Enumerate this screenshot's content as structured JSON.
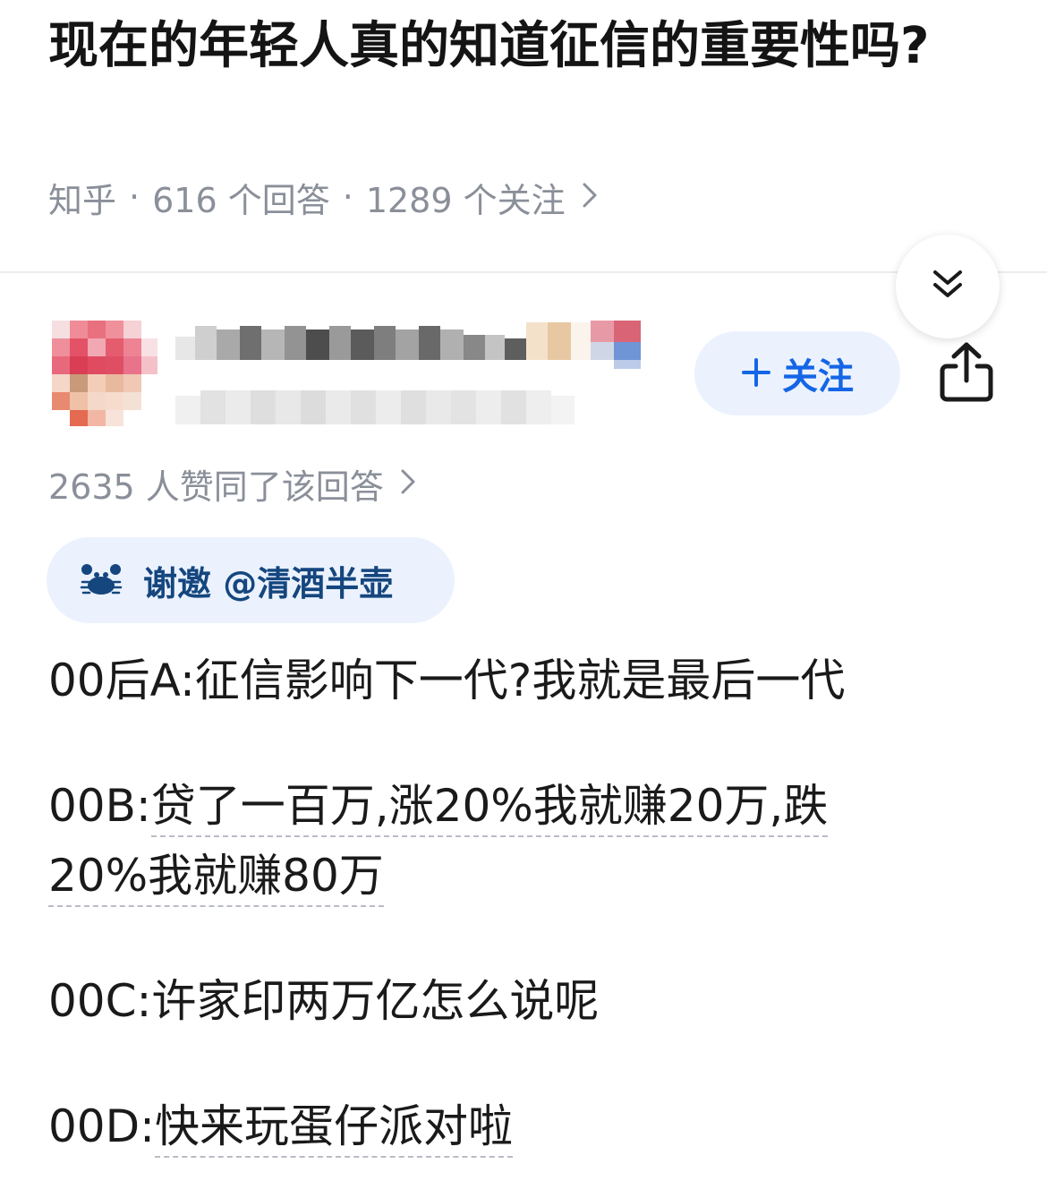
{
  "question": {
    "title": "现在的年轻人真的知道征信的重要性吗?",
    "source": "知乎",
    "separator": "·",
    "answers_count": "616 个回答",
    "followers_count": "1289 个关注"
  },
  "answer": {
    "follow_label": "关注",
    "follow_icon": "plus-icon",
    "vote_summary": "2635 人赞同了该回答",
    "invite_label": "谢邀 @清酒半壶",
    "lines": [
      {
        "prefix": "00后A:",
        "text": "征信影响下一代?我就是最后一代"
      },
      {
        "prefix": "00B:",
        "text": "贷了一百万,涨20%我就赚20万,跌",
        "cont": "20%我就赚80万"
      },
      {
        "prefix": "00C:",
        "text": "许家印两万亿怎么说呢"
      },
      {
        "prefix": "00D:",
        "text": "快来玩蛋仔派对啦"
      }
    ]
  },
  "icons": {
    "collapse": "double-chevron-down-icon",
    "share": "share-icon",
    "chevron": "chevron-right-icon",
    "invite": "crab-icon"
  },
  "colors": {
    "accent": "#1565e6",
    "pill_bg": "#ebf2fe",
    "meta_text": "#8a8f99",
    "invite_text": "#15467e"
  }
}
